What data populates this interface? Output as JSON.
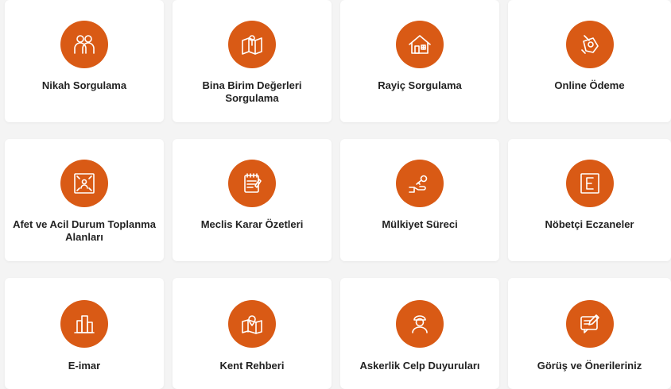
{
  "colors": {
    "accent": "#d95a15",
    "card": "#ffffff",
    "background": "#f4f4f4",
    "text": "#222222"
  },
  "services": [
    {
      "label": "Nikah Sorgulama",
      "icon": "couple-icon"
    },
    {
      "label": "Bina Birim Değerleri Sorgulama",
      "icon": "map-pin-icon"
    },
    {
      "label": "Rayiç Sorgulama",
      "icon": "house-icon"
    },
    {
      "label": "Online Ödeme",
      "icon": "payment-icon"
    },
    {
      "label": "Afet ve Acil Durum Toplanma Alanları",
      "icon": "assembly-area-icon"
    },
    {
      "label": "Meclis Karar Özetleri",
      "icon": "notepad-icon"
    },
    {
      "label": "Mülkiyet Süreci",
      "icon": "hand-key-icon"
    },
    {
      "label": "Nöbetçi Eczaneler",
      "icon": "pharmacy-e-icon"
    },
    {
      "label": "E-imar",
      "icon": "buildings-icon"
    },
    {
      "label": "Kent Rehberi",
      "icon": "city-map-icon"
    },
    {
      "label": "Askerlik Celp Duyuruları",
      "icon": "soldier-icon"
    },
    {
      "label": "Görüş ve Önerileriniz",
      "icon": "feedback-icon"
    }
  ]
}
